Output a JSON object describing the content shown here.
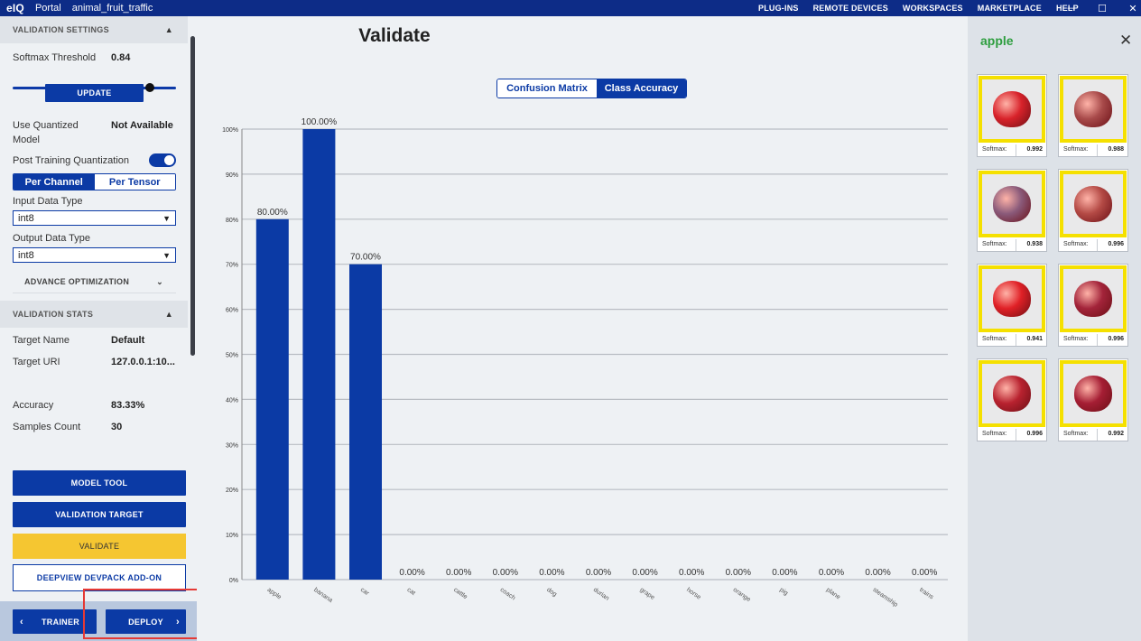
{
  "titlebar": {
    "logo": "eIQ",
    "portal": "Portal",
    "project": "animal_fruit_traffic",
    "nav": [
      "PLUG-INS",
      "REMOTE DEVICES",
      "WORKSPACES",
      "MARKETPLACE",
      "HELP"
    ]
  },
  "sidebar": {
    "validation_settings": "VALIDATION SETTINGS",
    "softmax_label": "Softmax Threshold",
    "softmax_value": "0.84",
    "softmax_level": 0.84,
    "update_button": "UPDATE",
    "quantized_label": "Use Quantized Model",
    "quantized_value": "Not Available",
    "ptq_label": "Post Training Quantization",
    "ptq_enabled": true,
    "per_channel": "Per Channel",
    "per_tensor": "Per Tensor",
    "input_type_label": "Input Data Type",
    "input_type_value": "int8",
    "output_type_label": "Output Data Type",
    "output_type_value": "int8",
    "advance_optimization": "ADVANCE OPTIMIZATION",
    "validation_stats": "VALIDATION STATS",
    "target_name_label": "Target Name",
    "target_name_value": "Default",
    "target_uri_label": "Target URI",
    "target_uri_value": "127.0.0.1:10...",
    "accuracy_label": "Accuracy",
    "accuracy_value": "83.33%",
    "samples_label": "Samples Count",
    "samples_value": "30",
    "model_tool": "MODEL TOOL",
    "validation_target": "VALIDATION TARGET",
    "validate": "VALIDATE",
    "deepview": "DEEPVIEW DEVPACK ADD-ON",
    "trainer": "TRAINER",
    "deploy": "DEPLOY"
  },
  "main": {
    "title": "Validate",
    "tab_confusion": "Confusion Matrix",
    "tab_accuracy": "Class Accuracy"
  },
  "chart_data": {
    "type": "bar",
    "categories": [
      "apple",
      "banana",
      "car",
      "cat",
      "cattle",
      "coach",
      "dog",
      "durian",
      "grape",
      "horse",
      "orange",
      "pig",
      "plane",
      "steamship",
      "trains"
    ],
    "values": [
      80,
      100,
      70,
      0,
      0,
      0,
      0,
      0,
      0,
      0,
      0,
      0,
      0,
      0,
      0
    ],
    "data_labels": [
      "80.00%",
      "100.00%",
      "70.00%",
      "0.00%",
      "0.00%",
      "0.00%",
      "0.00%",
      "0.00%",
      "0.00%",
      "0.00%",
      "0.00%",
      "0.00%",
      "0.00%",
      "0.00%",
      "0.00%"
    ],
    "yticks": [
      "0%",
      "10%",
      "20%",
      "30%",
      "40%",
      "50%",
      "60%",
      "70%",
      "80%",
      "90%",
      "100%"
    ],
    "ylim": [
      0,
      100
    ],
    "grid": true,
    "color": "#0b3aa5"
  },
  "right_panel": {
    "title": "apple",
    "softmax_label": "Softmax:",
    "samples": [
      "0.992",
      "0.988",
      "0.938",
      "0.996",
      "0.941",
      "0.996",
      "0.996",
      "0.992"
    ]
  }
}
